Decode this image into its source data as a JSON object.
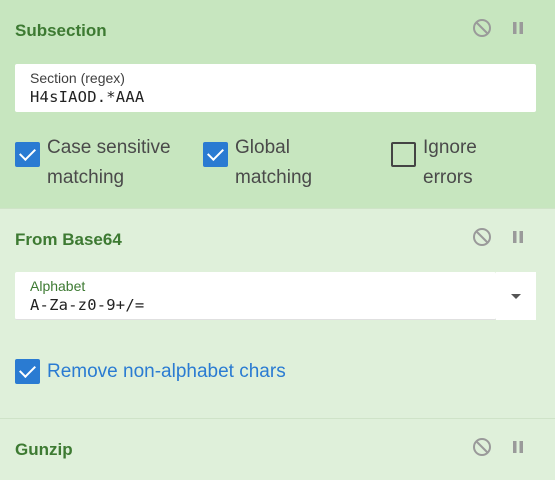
{
  "operations": [
    {
      "title": "Subsection",
      "field": {
        "label": "Section (regex)",
        "value": "H4sIAOD.*AAA"
      },
      "options": [
        {
          "label": "Case sensitive matching",
          "checked": true
        },
        {
          "label": "Global matching",
          "checked": true
        },
        {
          "label": "Ignore errors",
          "checked": false
        }
      ]
    },
    {
      "title": "From Base64",
      "field": {
        "label": "Alphabet",
        "value": "A-Za-z0-9+/="
      },
      "options": [
        {
          "label": "Remove non-alphabet chars",
          "checked": true
        }
      ]
    },
    {
      "title": "Gunzip"
    }
  ],
  "icons": {
    "disable": "disable-icon",
    "pause": "pause-icon"
  },
  "colors": {
    "active_bg": "#c7e6bf",
    "inactive_bg": "#dff0da",
    "title": "#3d7a32",
    "checkbox_on": "#2a7bd2"
  }
}
